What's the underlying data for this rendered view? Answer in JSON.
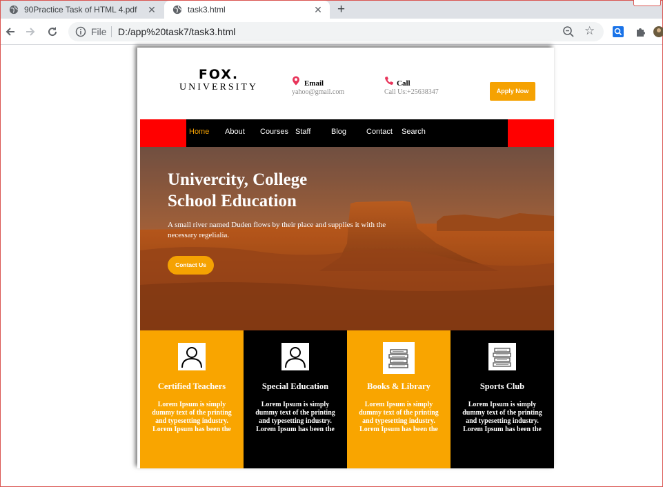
{
  "browser": {
    "tabs": [
      {
        "title": "90Practice Task of HTML 4.pdf",
        "active": false
      },
      {
        "title": "task3.html",
        "active": true
      }
    ],
    "address": {
      "scheme_label": "File",
      "url": "D:/app%20task7/task3.html"
    }
  },
  "site": {
    "logo": {
      "main": "FOX.",
      "sub": "UNIVERSITY"
    },
    "email": {
      "title": "Email",
      "value": "yahoo@gmail.com",
      "icon": "map-pin-icon"
    },
    "call": {
      "title": "Call",
      "value": "Call Us:+25638347",
      "icon": "phone-icon"
    },
    "apply_label": "Apply Now",
    "nav": [
      {
        "label": "Home",
        "active": true
      },
      {
        "label": "About",
        "active": false
      },
      {
        "label": "Courses",
        "active": false
      },
      {
        "label": "Staff",
        "active": false
      },
      {
        "label": "Blog",
        "active": false
      },
      {
        "label": "Contact",
        "active": false
      },
      {
        "label": "Search",
        "active": false
      }
    ],
    "hero": {
      "title_line1": "Univercity, College",
      "title_line2": "School Education",
      "text": "A small river named Duden flows by their place and supplies it with the necessary regelialia.",
      "button": "Contact Us"
    },
    "features": [
      {
        "title": "Certified Teachers",
        "text": "Lorem Ipsum is simply dummy text of the printing and typesetting industry. Lorem Ipsum has been the",
        "icon": "person-icon",
        "bg": "orange"
      },
      {
        "title": "Special Education",
        "text": "Lorem Ipsum is simply dummy text of the printing and typesetting industry. Lorem Ipsum has been the",
        "icon": "person-icon",
        "bg": "black"
      },
      {
        "title": "Books & Library",
        "text": "Lorem Ipsum is simply dummy text of the printing and typesetting industry. Lorem Ipsum has been the",
        "icon": "books-icon",
        "bg": "orange"
      },
      {
        "title": "Sports Club",
        "text": "Lorem Ipsum is simply dummy text of the printing and typesetting industry. Lorem Ipsum has been the",
        "icon": "books-icon",
        "bg": "black"
      }
    ]
  },
  "colors": {
    "accent": "#f5a202",
    "nav_bg": "#000000",
    "nav_side": "#ff0000",
    "pin": "#e8345a"
  }
}
